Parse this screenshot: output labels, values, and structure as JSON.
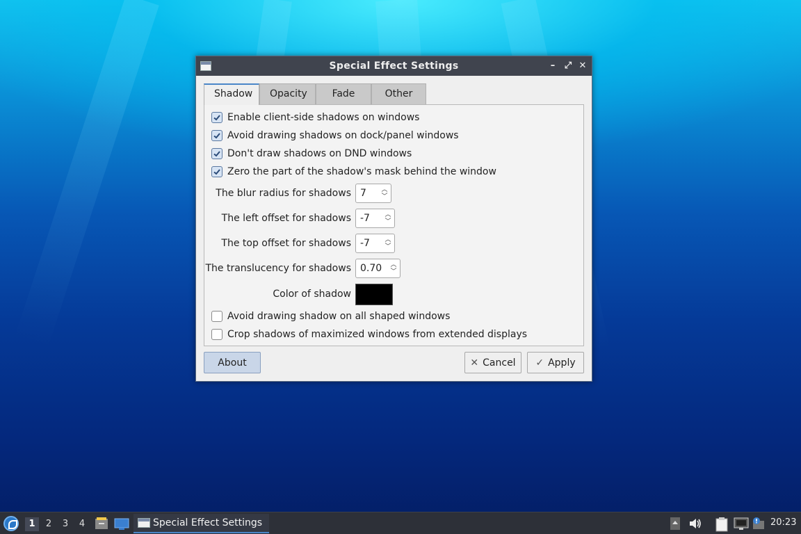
{
  "window": {
    "title": "Special Effect Settings",
    "controls": {
      "minimize": "–",
      "maximize": "⤢",
      "close": "✕"
    }
  },
  "tabs": [
    {
      "label": "Shadow",
      "active": true
    },
    {
      "label": "Opacity",
      "active": false
    },
    {
      "label": "Fade",
      "active": false
    },
    {
      "label": "Other",
      "active": false
    }
  ],
  "shadow": {
    "checkboxes_top": [
      {
        "label": "Enable client-side shadows on windows",
        "checked": true
      },
      {
        "label": "Avoid drawing shadows on dock/panel windows",
        "checked": true
      },
      {
        "label": "Don't draw shadows on DND windows",
        "checked": true
      },
      {
        "label": "Zero the part of the shadow's mask behind the window",
        "checked": true
      }
    ],
    "fields": {
      "blur_radius": {
        "label": "The blur radius for shadows",
        "value": "7"
      },
      "left_offset": {
        "label": "The left offset for shadows",
        "value": "-7"
      },
      "top_offset": {
        "label": "The top offset for shadows",
        "value": "-7"
      },
      "translucency": {
        "label": "The translucency for shadows",
        "value": "0.70"
      },
      "color": {
        "label": "Color of shadow",
        "value": "#000000"
      }
    },
    "checkboxes_bottom": [
      {
        "label": "Avoid drawing shadow on all shaped windows",
        "checked": false
      },
      {
        "label": "Crop shadows of maximized windows from extended displays",
        "checked": false
      }
    ]
  },
  "buttons": {
    "about": "About",
    "cancel": "Cancel",
    "apply": "Apply"
  },
  "taskbar": {
    "desktops": [
      "1",
      "2",
      "3",
      "4"
    ],
    "active_desktop": "1",
    "task_label": "Special Effect Settings",
    "clock": "20:23"
  },
  "colors": {
    "accent": "#4a86c8",
    "titlebar": "#40444e",
    "taskbar": "#2d3038"
  }
}
